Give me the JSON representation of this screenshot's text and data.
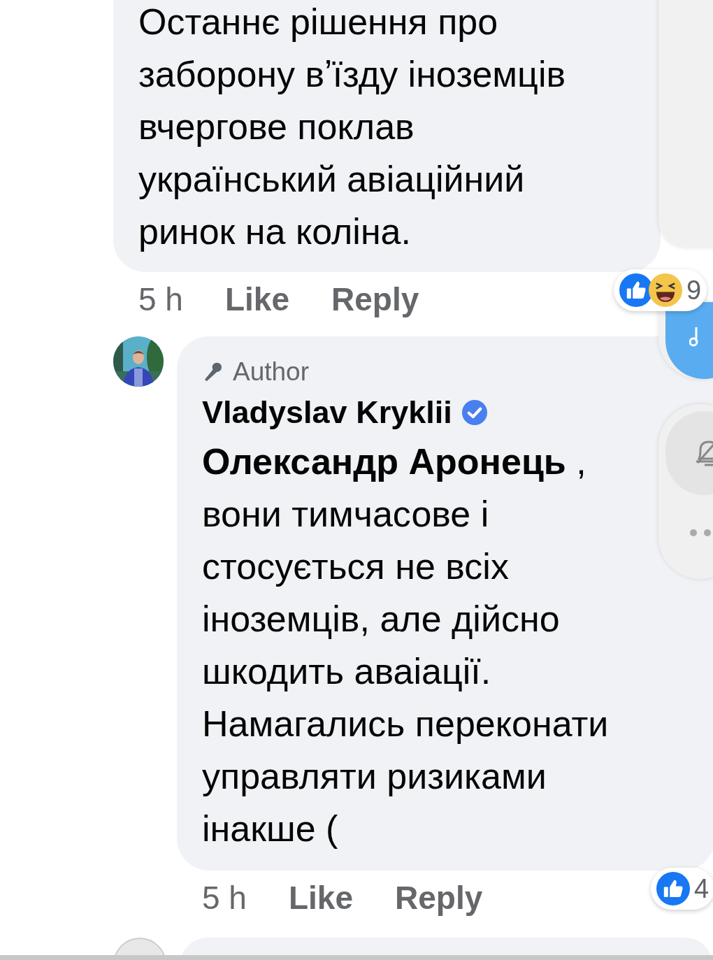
{
  "comments": [
    {
      "text": "Останнє рішення про заборону вʼїзду іноземців вчергове поклав український авіаційний ринок на коліна.",
      "time": "5 h",
      "actions": [
        "Like",
        "Reply"
      ],
      "reactions": {
        "icons": [
          {
            "kind": "like"
          },
          {
            "kind": "haha"
          }
        ],
        "count": "9"
      }
    },
    {
      "author_badge": "Author",
      "name": "Vladyslav Kryklii",
      "verified": true,
      "text": "**Олександр Аронець** , вони тимчасове і стосується не всіх іноземців, але дійсно шкодить аваіації. Намагались переконати управляти ризиками інакше (",
      "time": "5 h",
      "actions": [
        "Like",
        "Reply"
      ],
      "reactions": {
        "icons": [
          {
            "kind": "like"
          }
        ],
        "count": "4"
      }
    }
  ]
}
